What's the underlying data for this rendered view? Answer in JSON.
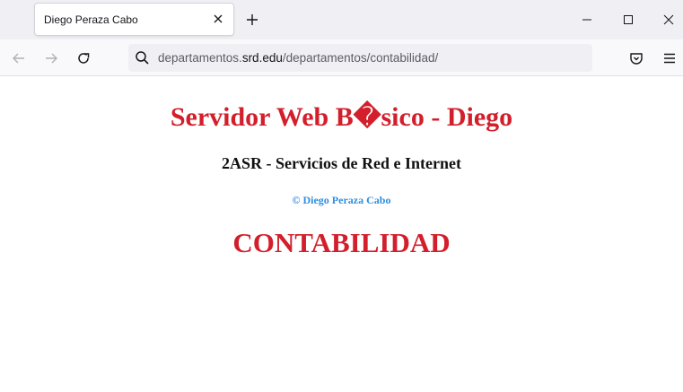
{
  "browser": {
    "tab": {
      "title": "Diego Peraza Cabo"
    },
    "url": {
      "prefix": "departamentos.",
      "domain": "srd.edu",
      "path": "/departamentos/contabilidad/"
    },
    "icons": {
      "close_tab": "close-icon",
      "new_tab": "plus-icon",
      "minimize": "minimize-icon",
      "maximize": "maximize-icon",
      "close_window": "close-icon",
      "back": "arrow-left-icon",
      "forward": "arrow-right-icon",
      "reload": "reload-icon",
      "search": "search-icon",
      "pocket": "pocket-icon",
      "menu": "hamburger-menu-icon"
    }
  },
  "page": {
    "heading": "Servidor Web B�sico - Diego",
    "subheading": "2ASR - Servicios de Red e Internet",
    "copyright": "© Diego Peraza Cabo",
    "department": "CONTABILIDAD"
  },
  "colors": {
    "heading": "#d21f2b",
    "copyright": "#2f8ee0"
  }
}
